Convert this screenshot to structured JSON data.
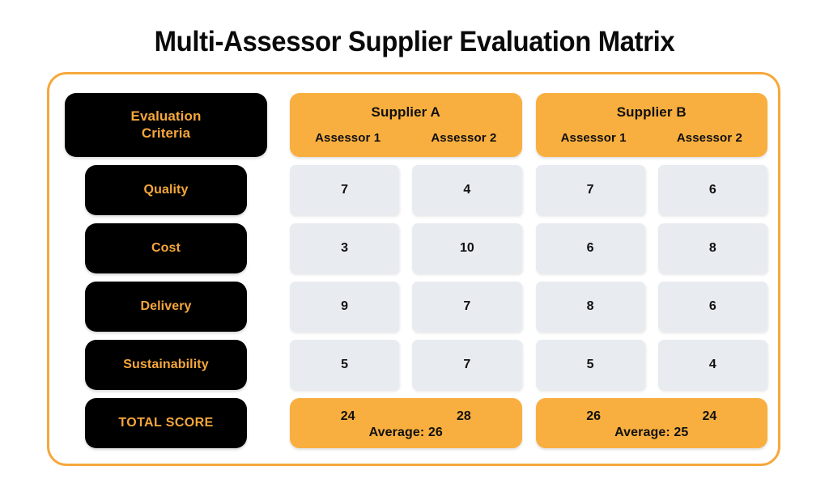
{
  "title": "Multi-Assessor Supplier Evaluation Matrix",
  "colors": {
    "accent_orange": "#F9AF3F",
    "border_orange": "#F5A83C",
    "label_text_orange": "#F5A73B",
    "label_bg_black": "#000000",
    "score_cell_bg": "#E8ECF1",
    "page_bg": "#FFFFFF"
  },
  "criteria_column": {
    "header": "Evaluation\nCriteria",
    "header_line1": "Evaluation",
    "header_line2": "Criteria",
    "rows": [
      {
        "label": "Quality"
      },
      {
        "label": "Cost"
      },
      {
        "label": "Delivery"
      },
      {
        "label": "Sustainability"
      },
      {
        "label": "TOTAL SCORE"
      }
    ]
  },
  "suppliers": [
    {
      "name": "Supplier A",
      "assessors": [
        "Assessor 1",
        "Assessor 2"
      ],
      "scores": {
        "Quality": [
          7,
          4
        ],
        "Cost": [
          3,
          10
        ],
        "Delivery": [
          9,
          7
        ],
        "Sustainability": [
          5,
          7
        ]
      },
      "totals": [
        24,
        28
      ],
      "average_label": "Average: 26",
      "average": 26
    },
    {
      "name": "Supplier B",
      "assessors": [
        "Assessor 1",
        "Assessor 2"
      ],
      "scores": {
        "Quality": [
          7,
          6
        ],
        "Cost": [
          6,
          8
        ],
        "Delivery": [
          8,
          6
        ],
        "Sustainability": [
          5,
          4
        ]
      },
      "totals": [
        26,
        24
      ],
      "average_label": "Average: 25",
      "average": 25
    }
  ],
  "chart_data": {
    "type": "table",
    "title": "Multi-Assessor Supplier Evaluation Matrix",
    "row_header_label": "Evaluation Criteria",
    "categories": [
      "Quality",
      "Cost",
      "Delivery",
      "Sustainability"
    ],
    "column_groups": [
      {
        "name": "Supplier A",
        "columns": [
          "Assessor 1",
          "Assessor 2"
        ]
      },
      {
        "name": "Supplier B",
        "columns": [
          "Assessor 1",
          "Assessor 2"
        ]
      }
    ],
    "series": [
      {
        "name": "Supplier A - Assessor 1",
        "values": [
          7,
          3,
          9,
          5
        ],
        "total": 24
      },
      {
        "name": "Supplier A - Assessor 2",
        "values": [
          4,
          10,
          7,
          7
        ],
        "total": 28
      },
      {
        "name": "Supplier B - Assessor 1",
        "values": [
          7,
          6,
          8,
          5
        ],
        "total": 26
      },
      {
        "name": "Supplier B - Assessor 2",
        "values": [
          6,
          8,
          6,
          4
        ],
        "total": 24
      }
    ],
    "summary_row_label": "TOTAL SCORE",
    "group_averages": [
      {
        "group": "Supplier A",
        "label": "Average: 26",
        "value": 26
      },
      {
        "group": "Supplier B",
        "label": "Average: 25",
        "value": 25
      }
    ],
    "score_scale": [
      0,
      10
    ]
  }
}
